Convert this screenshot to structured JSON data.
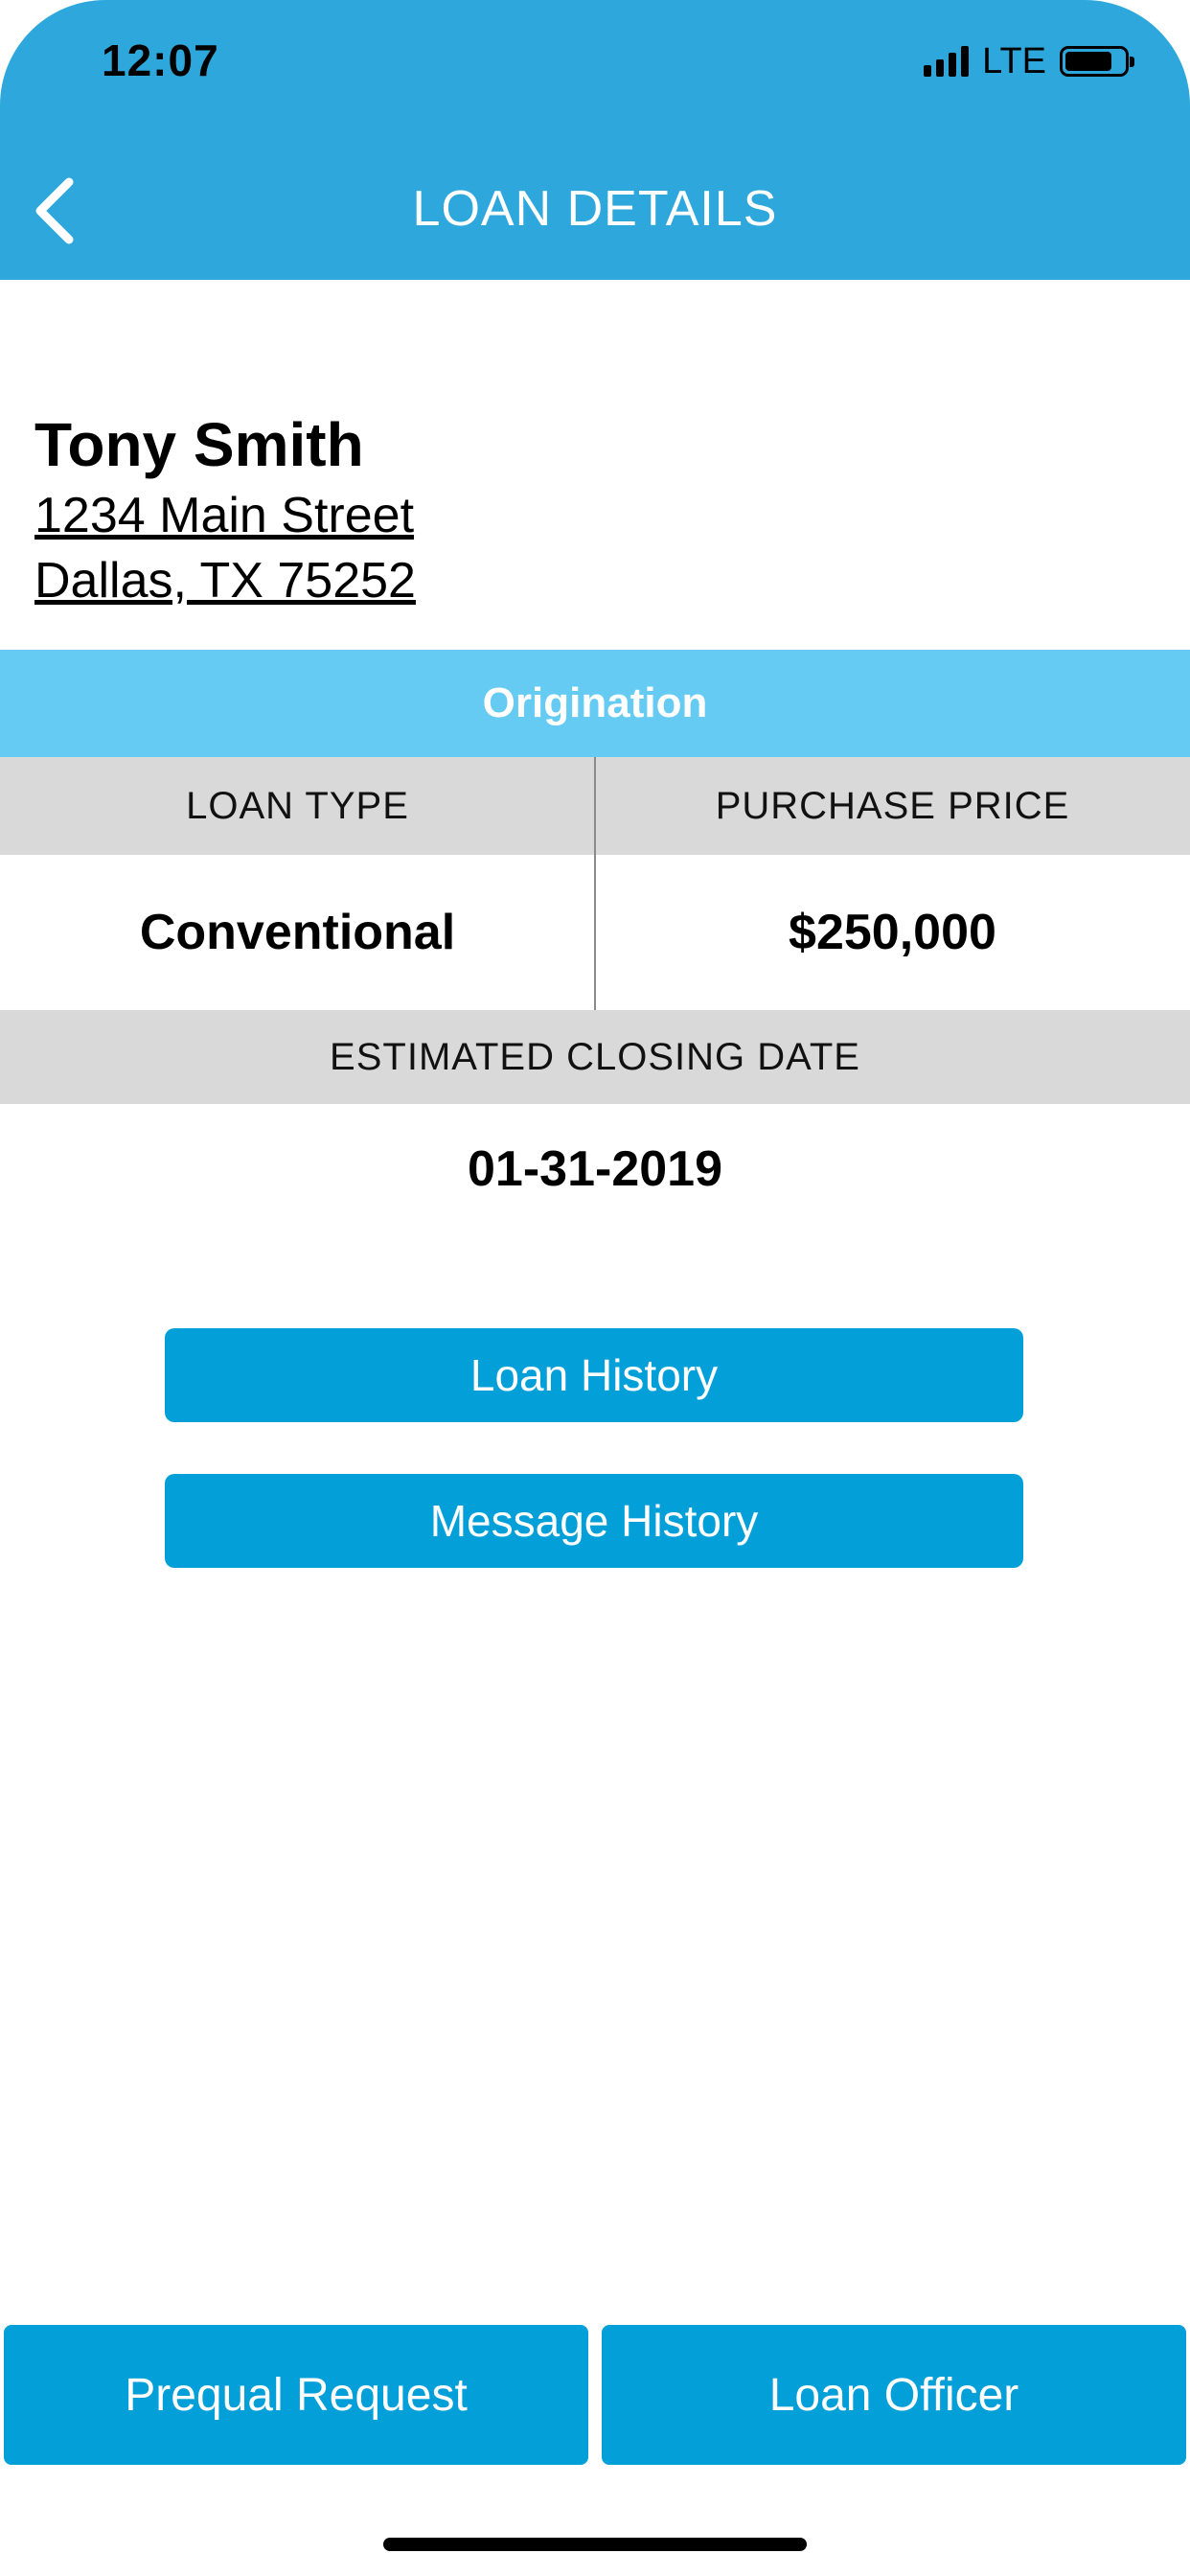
{
  "status_bar": {
    "time": "12:07",
    "network": "LTE",
    "signal_bars": 4,
    "battery_level": 0.8
  },
  "header": {
    "title": "LOAN DETAILS",
    "back_icon": "chevron-left-icon",
    "background_color": "#2ea8dc"
  },
  "borrower": {
    "name": "Tony Smith",
    "address_line1": "1234 Main Street",
    "address_line2": "Dallas, TX 75252"
  },
  "section": {
    "title": "Origination",
    "color": "#66cbf3"
  },
  "details": {
    "loan_type_label": "LOAN TYPE",
    "loan_type_value": "Conventional",
    "purchase_price_label": "PURCHASE PRICE",
    "purchase_price_value": "$250,000",
    "closing_date_label": "ESTIMATED CLOSING DATE",
    "closing_date_value": "01-31-2019"
  },
  "actions": {
    "loan_history": "Loan History",
    "message_history": "Message History",
    "button_color": "#039fd8"
  },
  "bottom_bar": {
    "prequal_request": "Prequal Request",
    "loan_officer": "Loan Officer"
  }
}
